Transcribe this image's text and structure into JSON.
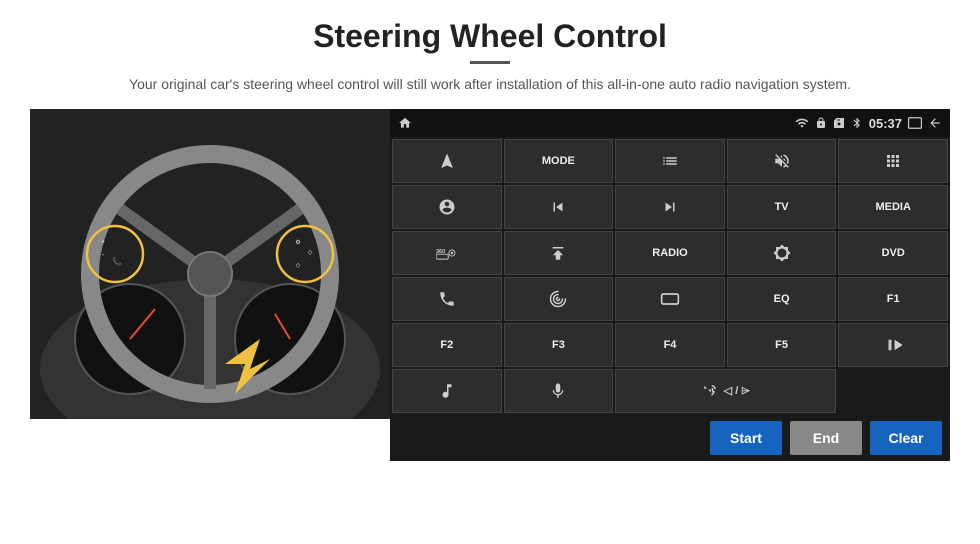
{
  "page": {
    "title": "Steering Wheel Control",
    "subtitle": "Your original car's steering wheel control will still work after installation of this all-in-one auto radio navigation system.",
    "divider": true
  },
  "status_bar": {
    "time": "05:37",
    "icons": [
      "wifi",
      "lock",
      "sim",
      "bluetooth",
      "rect",
      "back"
    ]
  },
  "buttons": [
    {
      "id": "b1",
      "label": "",
      "icon": "navigate"
    },
    {
      "id": "b2",
      "label": "MODE",
      "icon": ""
    },
    {
      "id": "b3",
      "label": "",
      "icon": "list"
    },
    {
      "id": "b4",
      "label": "",
      "icon": "mute"
    },
    {
      "id": "b5",
      "label": "",
      "icon": "apps"
    },
    {
      "id": "b6",
      "label": "",
      "icon": "settings-circle"
    },
    {
      "id": "b7",
      "label": "",
      "icon": "prev"
    },
    {
      "id": "b8",
      "label": "",
      "icon": "next"
    },
    {
      "id": "b9",
      "label": "TV",
      "icon": ""
    },
    {
      "id": "b10",
      "label": "MEDIA",
      "icon": ""
    },
    {
      "id": "b11",
      "label": "",
      "icon": "360cam"
    },
    {
      "id": "b12",
      "label": "",
      "icon": "eject"
    },
    {
      "id": "b13",
      "label": "RADIO",
      "icon": ""
    },
    {
      "id": "b14",
      "label": "",
      "icon": "brightness"
    },
    {
      "id": "b15",
      "label": "DVD",
      "icon": ""
    },
    {
      "id": "b16",
      "label": "",
      "icon": "phone"
    },
    {
      "id": "b17",
      "label": "",
      "icon": "swirl"
    },
    {
      "id": "b18",
      "label": "",
      "icon": "rectangle"
    },
    {
      "id": "b19",
      "label": "EQ",
      "icon": ""
    },
    {
      "id": "b20",
      "label": "F1",
      "icon": ""
    },
    {
      "id": "b21",
      "label": "F2",
      "icon": ""
    },
    {
      "id": "b22",
      "label": "F3",
      "icon": ""
    },
    {
      "id": "b23",
      "label": "F4",
      "icon": ""
    },
    {
      "id": "b24",
      "label": "F5",
      "icon": ""
    },
    {
      "id": "b25",
      "label": "",
      "icon": "play-pause"
    },
    {
      "id": "b26",
      "label": "",
      "icon": "music"
    },
    {
      "id": "b27",
      "label": "",
      "icon": "mic"
    },
    {
      "id": "b28",
      "label": "",
      "icon": "vol-phone",
      "span2": true
    }
  ],
  "bottom_bar": {
    "start_label": "Start",
    "end_label": "End",
    "clear_label": "Clear"
  }
}
